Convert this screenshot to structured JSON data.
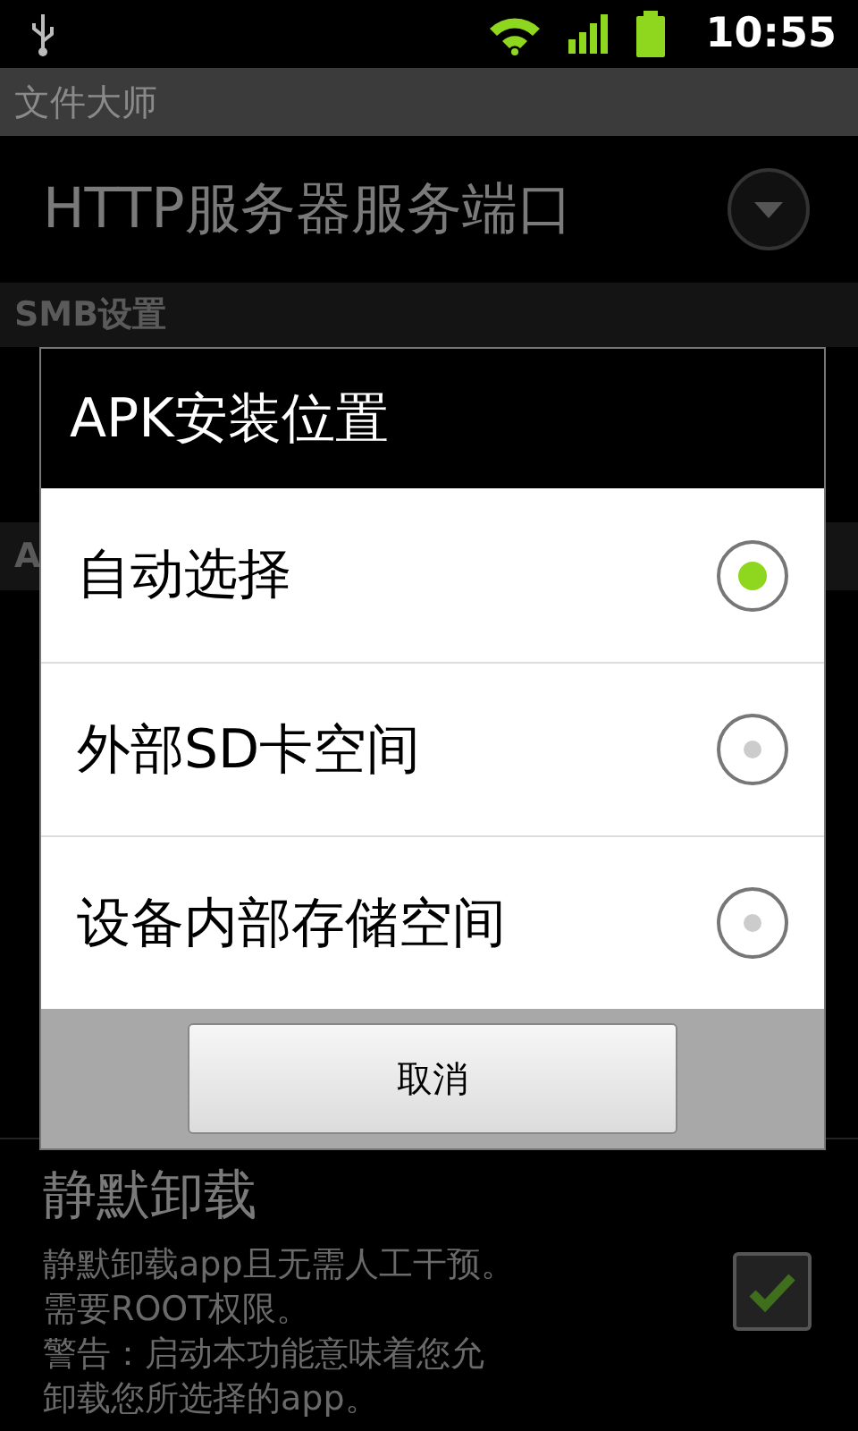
{
  "status_bar": {
    "time": "10:55"
  },
  "app_bar": {
    "title": "文件大师"
  },
  "settings": [
    {
      "kind": "dropdown",
      "title": "HTTP服务器服务端口"
    },
    {
      "kind": "header",
      "title": "SMB设置"
    },
    {
      "kind": "header",
      "title": "A"
    },
    {
      "kind": "checkbox",
      "title": "静默卸载",
      "summary_lines": [
        "静默卸载app且无需人工干预。",
        "需要ROOT权限。",
        "警告：启动本功能意味着您允",
        "卸载您所选择的app。"
      ],
      "checked": true
    }
  ],
  "dialog": {
    "title": "APK安装位置",
    "options": [
      {
        "label": "自动选择",
        "selected": true
      },
      {
        "label": "外部SD卡空间",
        "selected": false
      },
      {
        "label": "设备内部存储空间",
        "selected": false
      }
    ],
    "cancel": "取消"
  }
}
